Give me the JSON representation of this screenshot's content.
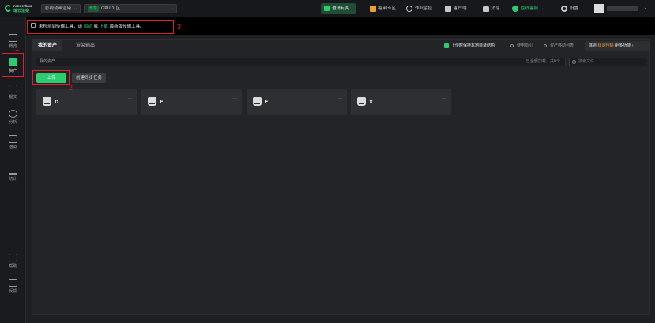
{
  "header": {
    "brand_en": "renderbus",
    "brand_cn": "瑞云渲染",
    "project": "影视动画渲染",
    "gpu_tag": "专享",
    "gpu_label": "GPU 1 区",
    "invite": "邀请有奖",
    "nav": [
      {
        "label": "福利专区",
        "icon": "gift-icon"
      },
      {
        "label": "作业监控",
        "icon": "monitor-icon"
      },
      {
        "label": "客户端",
        "icon": "desktop-icon"
      },
      {
        "label": "消息",
        "icon": "bell-icon"
      },
      {
        "label": "在线客服",
        "icon": "headset-icon"
      },
      {
        "label": "设置",
        "icon": "gear-icon"
      }
    ]
  },
  "sidebar": {
    "items": [
      {
        "label": "概览",
        "icon": "overview-icon"
      },
      {
        "label": "资产",
        "icon": "folder-icon"
      },
      {
        "label": "提交",
        "icon": "upload-icon"
      },
      {
        "label": "分析",
        "icon": "analyze-icon"
      },
      {
        "label": "渲染",
        "icon": "render-icon"
      },
      {
        "label": "统计",
        "icon": "chart-icon"
      },
      {
        "label": "帮助",
        "icon": "help-icon"
      },
      {
        "label": "反馈",
        "icon": "feedback-icon"
      }
    ]
  },
  "annotations": {
    "n1": "1",
    "n2": "2",
    "n3": "3"
  },
  "warning": {
    "prefix": "未检测到传输工具，请",
    "link1": "启动",
    "mid": "或",
    "link2": "下载",
    "suffix": "最新版传输工具。"
  },
  "panel": {
    "tabs": [
      "我的资产",
      "渲染输出"
    ],
    "options": {
      "keep_structure": "上传时保持本地目录结构",
      "guide": "使用指引",
      "transfer_list": "资产移动列表"
    },
    "promo": {
      "prefix": "体验",
      "highlight": "极速传输",
      "suffix": "更多功能 ›"
    },
    "path": "我的资产",
    "path_status": "已全部加载，共0个",
    "search_placeholder": "搜索文件",
    "upload_btn": "上传",
    "sync_btn": "创建同步任务",
    "drives": [
      {
        "label": "D",
        "more": "···"
      },
      {
        "label": "E",
        "more": "···"
      },
      {
        "label": "F",
        "more": "···"
      },
      {
        "label": "X",
        "more": "···"
      }
    ]
  },
  "colors": {
    "accent": "#2ecc71",
    "annotation": "#e0202a",
    "promo": "#f0a030"
  }
}
